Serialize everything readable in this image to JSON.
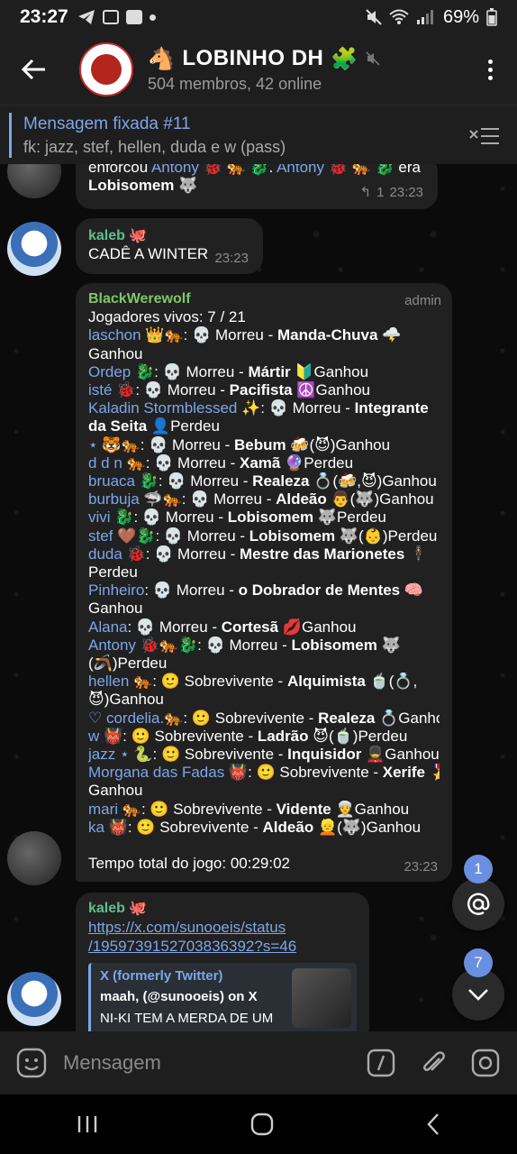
{
  "status": {
    "time": "23:27",
    "battery": "69%"
  },
  "header": {
    "title": "LOBINHO DH",
    "subtitle": "504 membros, 42 online"
  },
  "pinned": {
    "title": "Mensagem fixada #11",
    "text": "fk: jazz, stef, hellen, duda e w (pass)"
  },
  "messages": [
    {
      "id": "m1",
      "l1a": "enforcou ",
      "l1b": "Antony",
      "l1c": " 🐞 🐅 🐉. ",
      "l1d": "Antony",
      "l1e": " 🐞 🐅 🐉 era",
      "l2": "Lobisomem 🐺",
      "replies": "1",
      "time": "23:23"
    },
    {
      "id": "m2",
      "sender": "kaleb 🐙",
      "text": "CADÊ A WINTER",
      "time": "23:23"
    },
    {
      "id": "m3",
      "sender": "BlackWerewolf",
      "role": "admin",
      "time": "23:23",
      "header_line": "Jogadores vivos: 7 / 21",
      "lines": [
        {
          "n": "laschon 👑🐅",
          "a": ": 💀 Morreu - ",
          "b": "Manda-Chuva",
          "c": " 🌩️"
        },
        {
          "a": "Ganhou"
        },
        {
          "n": "Ordep 🐉",
          "a": ": 💀 Morreu - ",
          "b": "Mártir",
          "c": " 🔰Ganhou"
        },
        {
          "n": "isté 🐞",
          "a": ": 💀 Morreu - ",
          "b": "Pacifista",
          "c": " ☮️Ganhou"
        },
        {
          "n": "Kaladin Stormblessed ✨",
          "a": ": 💀 Morreu - ",
          "b": "Integrante",
          "c": ""
        },
        {
          "b": "da Seita",
          "c": " 👤Perdeu"
        },
        {
          "n": "⋆ 🐯🐅",
          "a": ": 💀 Morreu - ",
          "b": "Bebum",
          "c": " 🍻(😈)Ganhou"
        },
        {
          "n": "d d n 🐅",
          "a": ": 💀 Morreu - ",
          "b": "Xamã",
          "c": " 🔮Perdeu"
        },
        {
          "n": "bruaca 🐉",
          "a": ": 💀 Morreu - ",
          "b": "Realeza",
          "c": " 💍(🍻,😈)Ganhou"
        },
        {
          "n": "burbuja 🦈🐅",
          "a": ": 💀 Morreu - ",
          "b": "Aldeão",
          "c": " 👨(🐺)Ganhou"
        },
        {
          "n": "vivi 🐉",
          "a": ": 💀 Morreu - ",
          "b": "Lobisomem",
          "c": " 🐺Perdeu"
        },
        {
          "n": "stef 🤎🐉",
          "a": ": 💀 Morreu - ",
          "b": "Lobisomem",
          "c": " 🐺(👶)Perdeu"
        },
        {
          "n": "duda 🐞",
          "a": ": 💀 Morreu - ",
          "b": "Mestre das Marionetes",
          "c": " 🕴️"
        },
        {
          "a": "Perdeu"
        },
        {
          "n": "Pinheiro",
          "a": ": 💀 Morreu - ",
          "b": "o Dobrador de Mentes",
          "c": " 🧠"
        },
        {
          "a": "Ganhou"
        },
        {
          "n": "Alana",
          "a": ": 💀 Morreu - ",
          "b": "Cortesã",
          "c": " 💋Ganhou"
        },
        {
          "n": "Antony 🐞🐅🐉",
          "a": ": 💀 Morreu - ",
          "b": "Lobisomem",
          "c": " 🐺"
        },
        {
          "a": "(🪃)Perdeu"
        },
        {
          "n": "hellen 🐅",
          "a": ": 🙂 Sobrevivente - ",
          "b": "Alquimista",
          "c": " 🍵(💍,"
        },
        {
          "a": "😈)Ganhou"
        },
        {
          "n": "♡ cordelia.🐅",
          "a": ": 🙂 Sobrevivente - ",
          "b": "Realeza",
          "c": " 💍Ganhou"
        },
        {
          "n": "w 👹",
          "a": ": 🙂 Sobrevivente - ",
          "b": "Ladrão",
          "c": " 😈(🍵)Perdeu"
        },
        {
          "n": "jazz ⋆ 🐍",
          "a": ": 🙂 Sobrevivente - ",
          "b": "Inquisidor",
          "c": " 💂Ganhou"
        },
        {
          "n": "Morgana das Fadas 👹",
          "a": ": 🙂 Sobrevivente - ",
          "b": "Xerife",
          "c": " 🎖️"
        },
        {
          "a": "Ganhou"
        },
        {
          "n": "mari 🐅",
          "a": ": 🙂 Sobrevivente - ",
          "b": "Vidente",
          "c": " 👳Ganhou"
        },
        {
          "n": "ka 👹",
          "a": ": 🙂 Sobrevivente - ",
          "b": "Aldeão",
          "c": " 👱(🐺)Ganhou"
        }
      ],
      "footer": "Tempo total do jogo: 00:29:02"
    },
    {
      "id": "m4",
      "sender": "kaleb 🐙",
      "url1": "https://x.com/sunooeis/status",
      "url2": "/1959739152703836392?s=46",
      "preview": {
        "site": "X (formerly Twitter)",
        "author": "maah, (@sunooeis) on X",
        "text": "NI-KI TEM A MERDA DE UM"
      }
    }
  ],
  "fabs": {
    "mentions_badge": "1",
    "unread_badge": "7"
  },
  "input": {
    "placeholder": "Mensagem"
  }
}
